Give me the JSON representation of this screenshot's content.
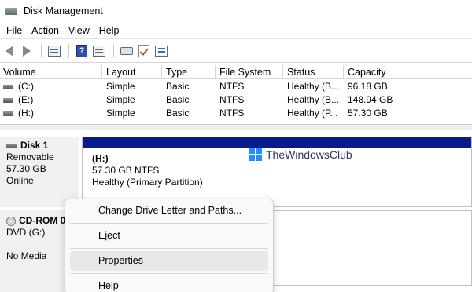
{
  "window": {
    "title": "Disk Management"
  },
  "menu": [
    "File",
    "Action",
    "View",
    "Help"
  ],
  "toolbar": {
    "buttons": [
      {
        "name": "back-arrow-icon"
      },
      {
        "name": "forward-arrow-icon"
      },
      {
        "name": "show-hide-console-tree-icon"
      },
      {
        "name": "help-icon",
        "glyph": "?"
      },
      {
        "name": "properties-icon"
      },
      {
        "name": "connect-drive-icon"
      },
      {
        "name": "checkmark-icon"
      },
      {
        "name": "list-view-icon"
      }
    ]
  },
  "volume_table": {
    "columns": [
      "Volume",
      "Layout",
      "Type",
      "File System",
      "Status",
      "Capacity"
    ],
    "rows": [
      {
        "volume": "(C:)",
        "layout": "Simple",
        "type": "Basic",
        "fs": "NTFS",
        "status": "Healthy (B...",
        "capacity": "96.18 GB"
      },
      {
        "volume": "(E:)",
        "layout": "Simple",
        "type": "Basic",
        "fs": "NTFS",
        "status": "Healthy (B...",
        "capacity": "148.94 GB"
      },
      {
        "volume": "(H:)",
        "layout": "Simple",
        "type": "Basic",
        "fs": "NTFS",
        "status": "Healthy (P...",
        "capacity": "57.30 GB"
      }
    ]
  },
  "disk1": {
    "name": "Disk 1",
    "kind": "Removable",
    "size": "57.30 GB",
    "state": "Online",
    "partition": {
      "title": "(H:)",
      "size_fs": "57.30 GB NTFS",
      "status": "Healthy (Primary Partition)",
      "bar_color": "#0a1a8c"
    }
  },
  "cdrom": {
    "name": "CD-ROM 0",
    "drive": "DVD (G:)",
    "media": "No Media"
  },
  "watermark": {
    "text": "TheWindowsClub"
  },
  "context_menu": {
    "items": [
      {
        "label": "Change Drive Letter and Paths...",
        "highlighted": false
      },
      {
        "label": "Eject",
        "highlighted": false
      },
      {
        "label": "Properties",
        "highlighted": true
      },
      {
        "label": "Help",
        "highlighted": false
      }
    ]
  }
}
